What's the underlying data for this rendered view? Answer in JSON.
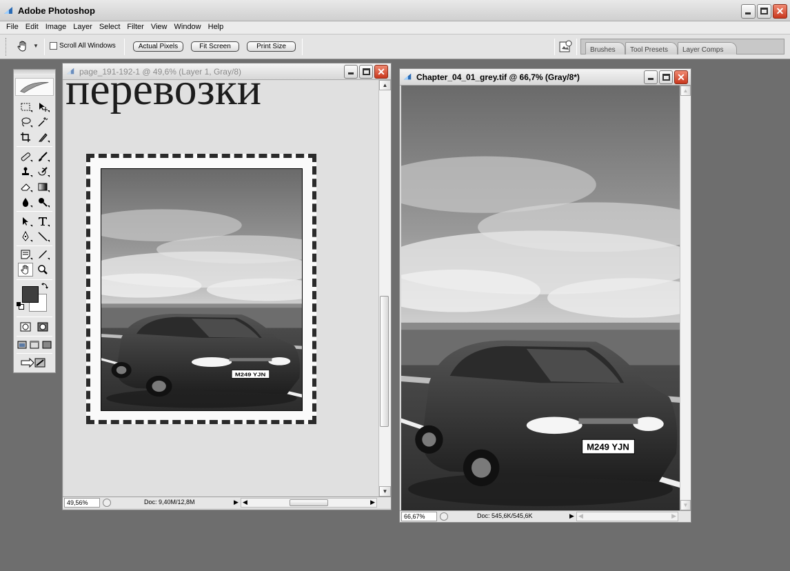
{
  "app": {
    "title": "Adobe Photoshop"
  },
  "menu": [
    "File",
    "Edit",
    "Image",
    "Layer",
    "Select",
    "Filter",
    "View",
    "Window",
    "Help"
  ],
  "options": {
    "scroll_all_windows": "Scroll All Windows",
    "actual_pixels": "Actual Pixels",
    "fit_screen": "Fit Screen",
    "print_size": "Print Size"
  },
  "palette_well": {
    "tabs": [
      "Brushes",
      "Tool Presets",
      "Layer Comps"
    ]
  },
  "toolbox": {
    "foreground_color": "#3e3e3e",
    "background_color": "#ffffff",
    "active_tool": "hand-tool"
  },
  "doc1": {
    "title": "page_191-192-1 @ 49,6% (Layer 1, Gray/8)",
    "canvas_text": "перевозки",
    "zoom": "49,56%",
    "doc_size": "Doc: 9,40M/12,8M",
    "plate_text": "M249 YJN"
  },
  "doc2": {
    "title": "Chapter_04_01_grey.tif @ 66,7% (Gray/8*)",
    "zoom": "66,67%",
    "doc_size": "Doc: 545,6K/545,6K",
    "plate_text": "M249 YJN"
  }
}
